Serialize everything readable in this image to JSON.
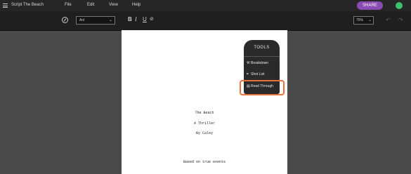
{
  "app": {
    "title": "Script The Beach"
  },
  "menu": {
    "file": "File",
    "edit": "Edit",
    "view": "View",
    "help": "Help"
  },
  "share": {
    "label": "SHARE"
  },
  "toolbar": {
    "element_select": "Act",
    "bold": "B",
    "italic": "I",
    "underline": "U",
    "zoom": "75%"
  },
  "script": {
    "title": "The Beach",
    "genre": "A Thriller",
    "author": "By Caley",
    "note": "Based on true events"
  },
  "tools_panel": {
    "title": "TOOLS",
    "items": [
      "Breakdown",
      "Shot List",
      "Read Through"
    ]
  },
  "colors": {
    "accent": "#8b4bb5",
    "avatar": "#3cc26c",
    "highlight": "#e8713a"
  }
}
